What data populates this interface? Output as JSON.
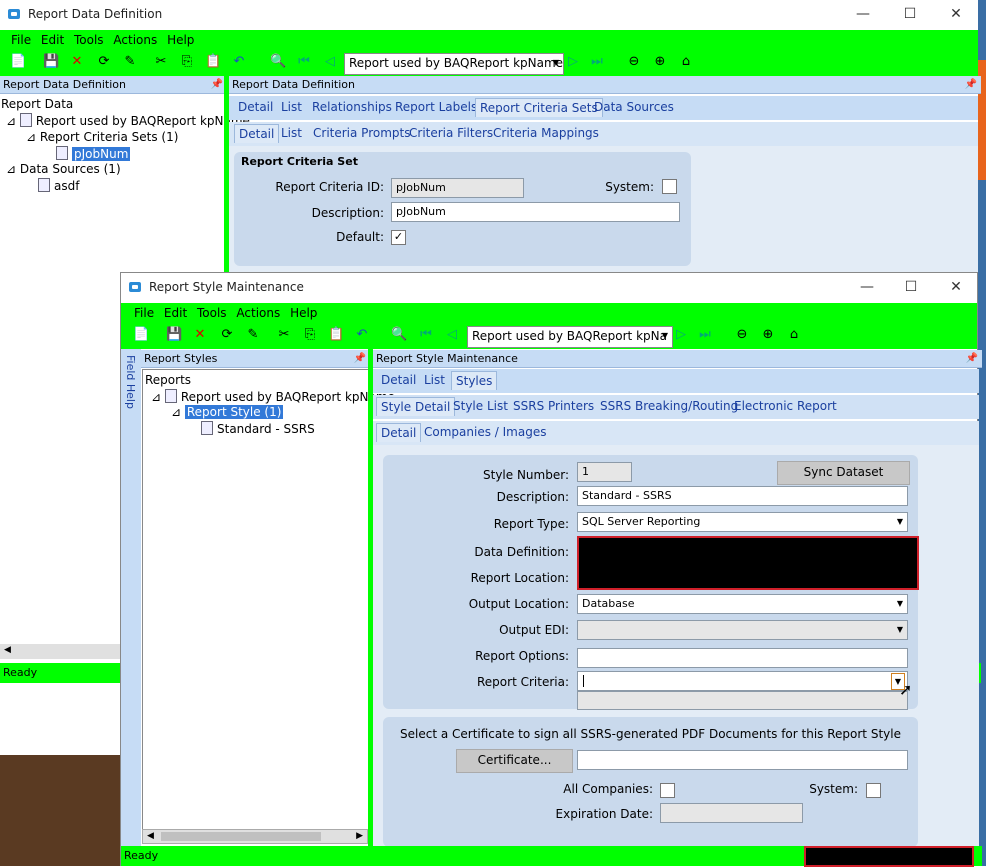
{
  "back_window": {
    "title": "Report Data Definition",
    "menu": [
      "File",
      "Edit",
      "Tools",
      "Actions",
      "Help"
    ],
    "nav_combo": "Report used by BAQReport kpName",
    "left_panel_title": "Report Data Definition",
    "right_panel_title": "Report Data Definition",
    "tree": {
      "root": "Report Data",
      "report": "Report used by BAQReport kpName",
      "criteria_sets": "Report Criteria Sets (1)",
      "criteria_item": "pJobNum",
      "data_sources": "Data Sources (1)",
      "data_item": "asdf"
    },
    "tabs1": [
      "Detail",
      "List",
      "Relationships",
      "Report Labels",
      "Report Criteria Sets",
      "Data Sources"
    ],
    "tabs2": [
      "Detail",
      "List",
      "Criteria Prompts",
      "Criteria Filters",
      "Criteria Mappings"
    ],
    "group_title": "Report Criteria Set",
    "criteria_id_label": "Report Criteria ID:",
    "criteria_id_value": "pJobNum",
    "system_label": "System:",
    "description_label": "Description:",
    "description_value": "pJobNum",
    "default_label": "Default:",
    "default_check": "✓",
    "status": "Ready"
  },
  "front_window": {
    "title": "Report Style Maintenance",
    "menu": [
      "File",
      "Edit",
      "Tools",
      "Actions",
      "Help"
    ],
    "nav_combo": "Report used by BAQReport kpNa",
    "field_help": "Field Help",
    "left_panel_title": "Report Styles",
    "right_panel_title": "Report Style Maintenance",
    "tree": {
      "root": "Reports",
      "report": "Report used by BAQReport kpName",
      "style": "Report Style (1)",
      "style_item": "Standard - SSRS"
    },
    "tabs1": [
      "Detail",
      "List",
      "Styles"
    ],
    "tabs2": [
      "Style Detail",
      "Style List",
      "SSRS Printers",
      "SSRS Breaking/Routing",
      "Electronic Report"
    ],
    "tabs3": [
      "Detail",
      "Companies / Images"
    ],
    "style_number_label": "Style Number:",
    "style_number_value": "1",
    "sync_button": "Sync Dataset",
    "description_label": "Description:",
    "description_value": "Standard - SSRS",
    "report_type_label": "Report Type:",
    "report_type_value": "SQL Server Reporting",
    "data_definition_label": "Data Definition:",
    "report_location_label": "Report Location:",
    "output_location_label": "Output Location:",
    "output_location_value": "Database",
    "output_edi_label": "Output EDI:",
    "report_options_label": "Report Options:",
    "report_criteria_label": "Report Criteria:",
    "certificate_text": "Select a Certificate to sign all SSRS-generated PDF Documents for this Report Style",
    "certificate_button": "Certificate...",
    "all_companies_label": "All Companies:",
    "system_label": "System:",
    "expiration_label": "Expiration Date:",
    "status": "Ready"
  },
  "colors": {
    "toolbar_green": "#00ff00",
    "panel_blue": "#c6dcf5",
    "redaction": "#000000",
    "redaction_border": "#d0202a"
  }
}
